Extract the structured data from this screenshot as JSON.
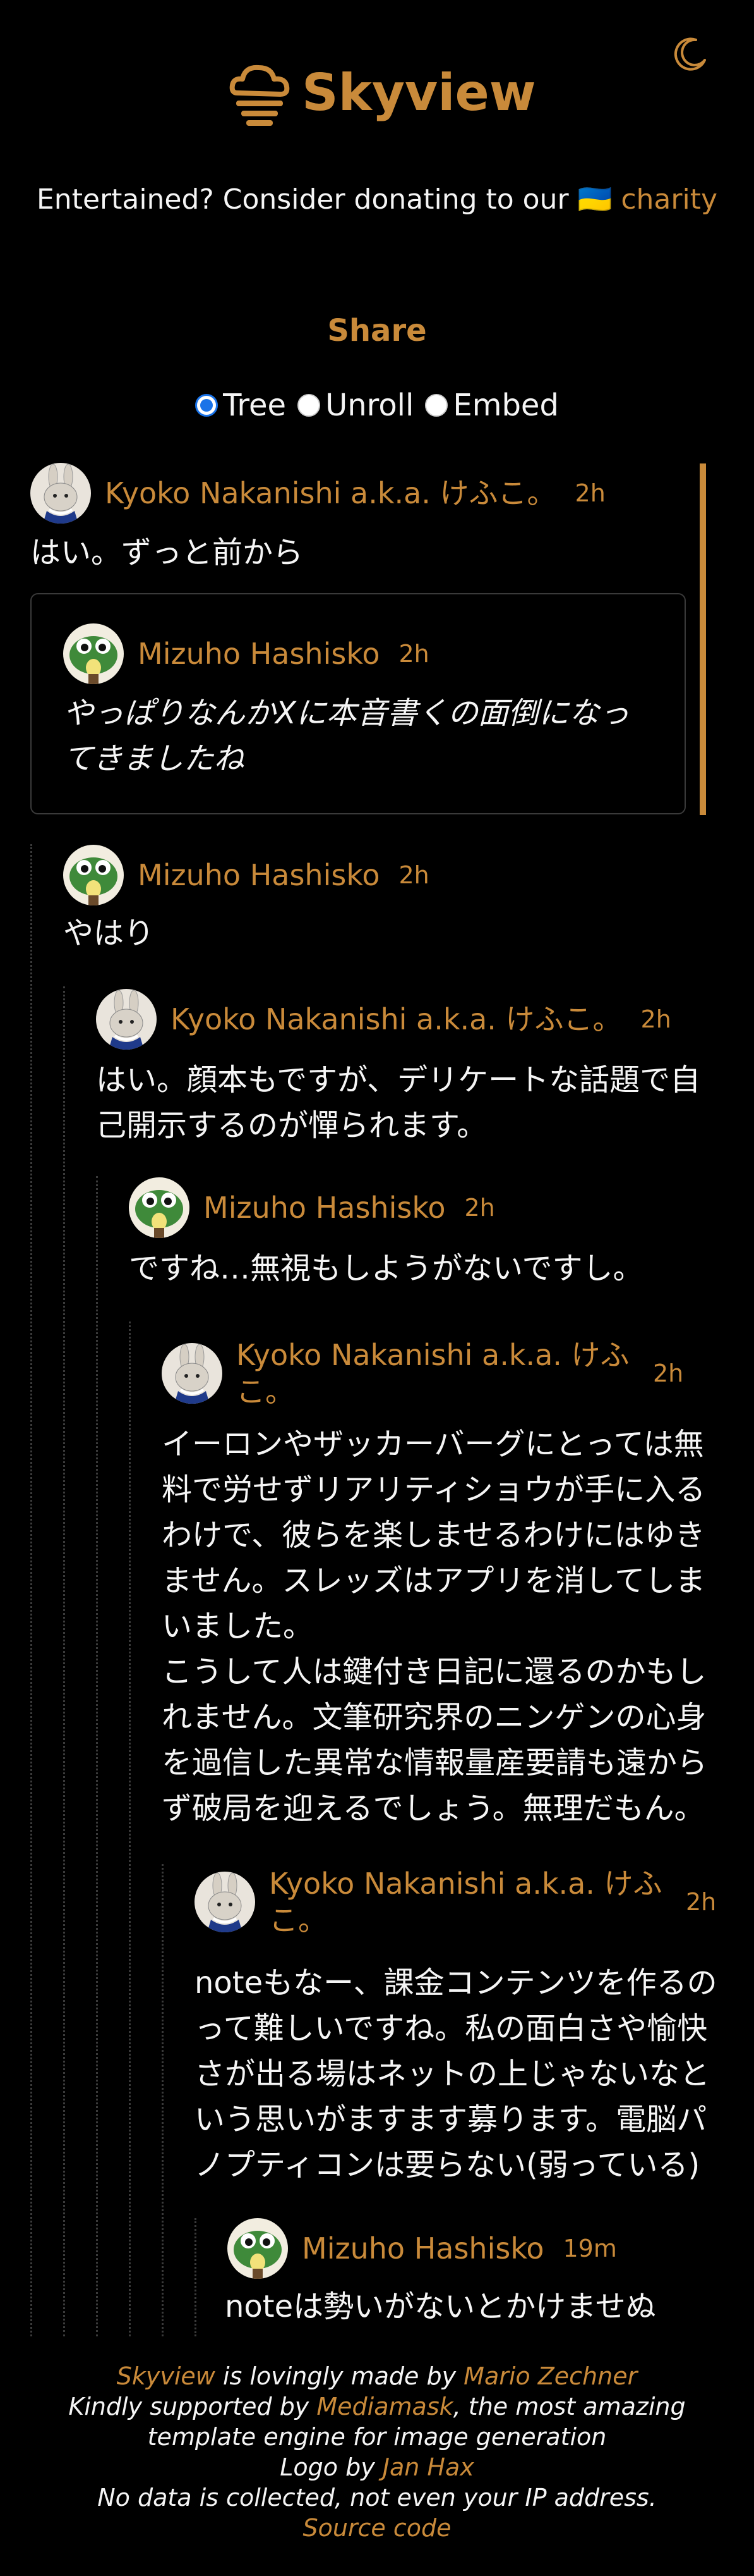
{
  "header": {
    "brand": "Skyview",
    "theme_icon": "moon-icon",
    "logo_icon": "cloud-stack-logo"
  },
  "donate": {
    "text": "Entertained? Consider donating to our ",
    "flag": "🇺🇦",
    "link": "charity"
  },
  "share": {
    "title": "Share",
    "options": [
      {
        "label": "Tree",
        "checked": true
      },
      {
        "label": "Unroll",
        "checked": false
      },
      {
        "label": "Embed",
        "checked": false
      }
    ]
  },
  "posts": [
    {
      "author": "Kyoko Nakanishi a.k.a. けふこ。",
      "time": "2h",
      "text": "はい。ずっと前から"
    },
    {
      "author": "Mizuho Hashisko",
      "time": "2h",
      "text_lines": [
        "やっぱりなんかXに本音書くの面倒になっ",
        "てきましたね"
      ]
    },
    {
      "author": "Mizuho Hashisko",
      "time": "2h",
      "text": "やはり"
    },
    {
      "author": "Kyoko Nakanishi a.k.a. けふこ。",
      "time": "2h",
      "text_lines": [
        "はい。顔本もですが、デリケートな話題で自",
        "己開示するのが憚られます。"
      ]
    },
    {
      "author": "Mizuho Hashisko",
      "time": "2h",
      "text": "ですね…無視もしようがないですし。"
    },
    {
      "author_lines": [
        "Kyoko Nakanishi a.k.a. けふ",
        "こ。"
      ],
      "time": "2h",
      "text_lines": [
        "イーロンやザッカーバーグにとっては無",
        "料で労せずリアリティショウが手に入る",
        "わけで、彼らを楽しませるわけにはゆき",
        "ません。スレッズはアプリを消してしま",
        "いました。",
        "こうして人は鍵付き日記に還るのかもし",
        "れません。文筆研究界のニンゲンの心身",
        "を過信した異常な情報量産要請も遠から",
        "ず破局を迎えるでしょう。無理だもん。"
      ]
    },
    {
      "author_lines": [
        "Kyoko Nakanishi a.k.a. けふ",
        "こ。"
      ],
      "time": "2h",
      "text_lines": [
        "noteもなー、課金コンテンツを作るの",
        "って難しいですね。私の面白さや愉快",
        "さが出る場はネットの上じゃないなと",
        "いう思いがますます募ります。電脳パ",
        "ノプティコンは要らない(弱っている)"
      ]
    },
    {
      "author": "Mizuho Hashisko",
      "time": "19m",
      "text": "noteは勢いがないとかけませぬ"
    }
  ],
  "footer": {
    "l1_link": "Skyview",
    "l1_text": " is lovingly made by ",
    "l1_link2": "Mario Zechner",
    "l2_text": "Kindly supported by ",
    "l2_link": "Mediamask",
    "l2_text2": ", the most amazing",
    "l3_text": "template engine for image generation",
    "l4_text": "Logo by ",
    "l4_link": "Jan Hax",
    "l5_text": "No data is collected, not even your IP address.",
    "l6_link": "Source code"
  },
  "colors": {
    "accent": "#c98a3a",
    "background": "#000000",
    "text": "#f5f5f5"
  }
}
